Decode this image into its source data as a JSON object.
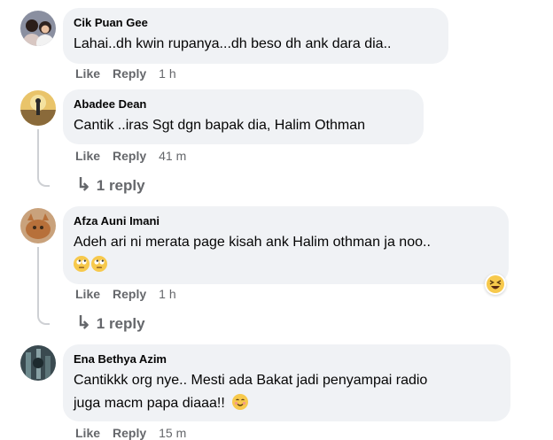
{
  "comments": [
    {
      "author": "Cik Puan Gee",
      "text": "Lahai..dh kwin rupanya...dh beso dh ank dara dia..",
      "like": "Like",
      "reply": "Reply",
      "time": "1 h",
      "avatar": "avatar-two-people"
    },
    {
      "author": "Abadee Dean",
      "text": "Cantik ..iras Sgt dgn bapak dia, Halim Othman",
      "like": "Like",
      "reply": "Reply",
      "time": "41 m",
      "replies": "1 reply",
      "avatar": "avatar-sunset-person"
    },
    {
      "author": "Afza Auni Imani",
      "text": "Adeh ari ni merata page kisah ank Halim othman ja noo..",
      "emojis": "rolling-eyes-emoji x2",
      "like": "Like",
      "reply": "Reply",
      "time": "1 h",
      "replies": "1 reply",
      "reaction": "laughing-squint-emoji",
      "avatar": "avatar-cat"
    },
    {
      "author": "Ena Bethya Azim",
      "text_line1": "Cantikkk org nye.. Mesti ada Bakat jadi penyampai radio",
      "text_line2": "juga macm papa diaaa!!",
      "emoji": "smiling-blush-emoji",
      "like": "Like",
      "reply": "Reply",
      "time": "15 m",
      "avatar": "avatar-dark-scene"
    }
  ],
  "colors": {
    "bubble": "#f0f2f5",
    "meta": "#65676b",
    "thread": "#ced0d4"
  }
}
